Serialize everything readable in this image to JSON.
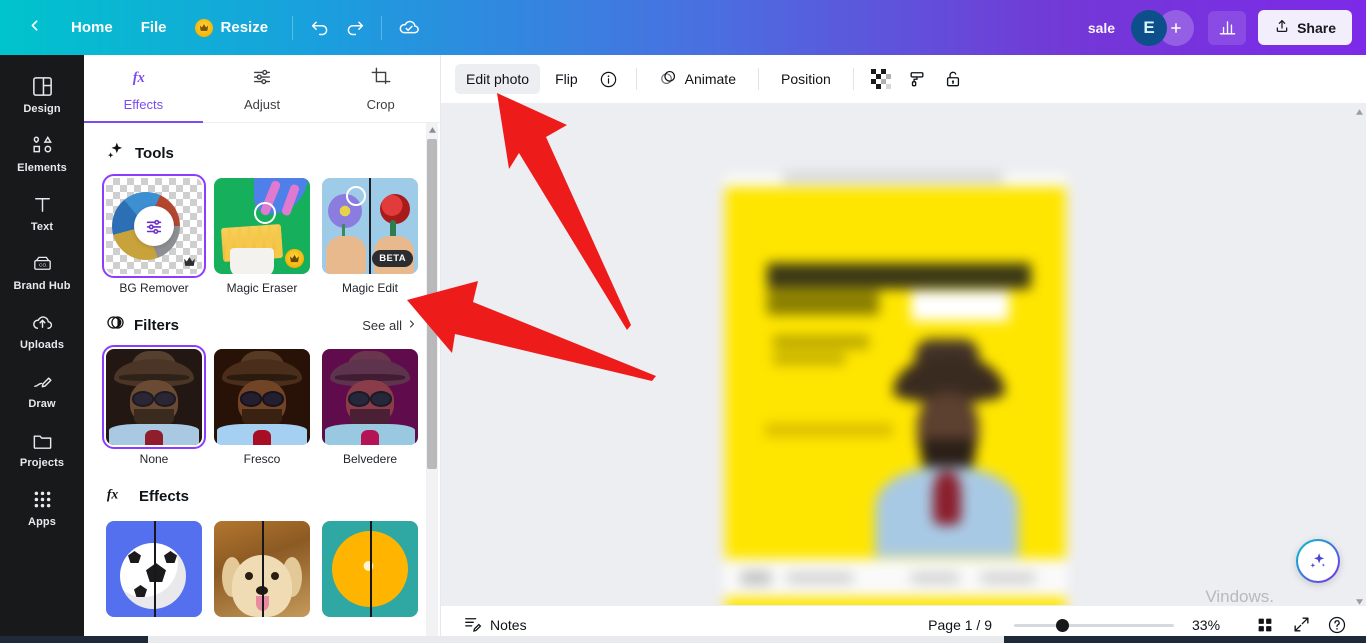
{
  "topbar": {
    "back_icon": "chevron-left-icon",
    "home_label": "Home",
    "file_label": "File",
    "resize_label": "Resize",
    "resize_badge_icon": "crown-icon",
    "undo_icon": "undo-icon",
    "redo_icon": "redo-icon",
    "cloud_icon": "cloud-saved-icon",
    "sale_label": "sale",
    "avatar_initial": "E",
    "add_member_icon": "plus-icon",
    "insights_icon": "bar-chart-icon",
    "share_icon": "share-upload-icon",
    "share_label": "Share",
    "accent_gradient_start": "#00c4cc",
    "accent_gradient_end": "#7d2ae8"
  },
  "sidebar": {
    "items": [
      {
        "label": "Design",
        "icon": "layout-grid-icon"
      },
      {
        "label": "Elements",
        "icon": "shapes-icon"
      },
      {
        "label": "Text",
        "icon": "text-t-icon"
      },
      {
        "label": "Brand Hub",
        "icon": "brand-card-icon"
      },
      {
        "label": "Uploads",
        "icon": "cloud-upload-icon"
      },
      {
        "label": "Draw",
        "icon": "pen-draw-icon"
      },
      {
        "label": "Projects",
        "icon": "folder-icon"
      },
      {
        "label": "Apps",
        "icon": "apps-grid-icon"
      }
    ]
  },
  "panel": {
    "tabs": [
      {
        "label": "Effects",
        "icon": "fx-icon",
        "active": true
      },
      {
        "label": "Adjust",
        "icon": "sliders-icon",
        "active": false
      },
      {
        "label": "Crop",
        "icon": "crop-icon",
        "active": false
      }
    ],
    "tools_section": {
      "title": "Tools",
      "icon": "sparkle-icon",
      "items": [
        {
          "label": "BG Remover",
          "badge": "crown",
          "selected": true
        },
        {
          "label": "Magic Eraser",
          "badge": "crown",
          "selected": false
        },
        {
          "label": "Magic Edit",
          "badge": "BETA",
          "selected": false
        }
      ]
    },
    "filters_section": {
      "title": "Filters",
      "icon": "filter-circle-icon",
      "see_all_label": "See all",
      "see_all_icon": "chevron-right-icon",
      "items": [
        {
          "label": "None",
          "selected": true
        },
        {
          "label": "Fresco",
          "selected": false
        },
        {
          "label": "Belvedere",
          "selected": false
        }
      ]
    },
    "effects_section": {
      "title": "Effects",
      "icon": "fx-icon",
      "items": [
        {
          "label": ""
        },
        {
          "label": ""
        },
        {
          "label": ""
        }
      ]
    }
  },
  "editor_toolbar": {
    "edit_photo_label": "Edit photo",
    "flip_label": "Flip",
    "info_icon": "info-circle-icon",
    "animate_label": "Animate",
    "animate_icon": "animate-circles-icon",
    "position_label": "Position",
    "transparency_icon": "transparency-checker-icon",
    "paint_roller_icon": "paint-roller-icon",
    "lock_icon": "unlock-icon"
  },
  "canvas": {
    "ai_assistant_icon": "sparkle-ai-icon",
    "watermark_text": "Vindows.",
    "collapse_icon": "chevron-up-icon",
    "scroll_left_icon": "triangle-left-icon",
    "scroll_right_icon": "triangle-right-icon",
    "scroll_up_icon": "triangle-up-icon",
    "scroll_down_icon": "triangle-down-icon"
  },
  "bottombar": {
    "notes_label": "Notes",
    "notes_icon": "notes-icon",
    "page_indicator": "Page 1 / 9",
    "zoom_value": "33%",
    "grid_view_icon": "grid-view-icon",
    "fullscreen_icon": "fullscreen-expand-icon",
    "help_icon": "help-question-icon"
  },
  "annotations": {
    "arrow_1": "red-arrow-to-edit-photo",
    "arrow_2": "red-arrow-to-magic-edit",
    "arrow_color": "#ee1b1b"
  }
}
